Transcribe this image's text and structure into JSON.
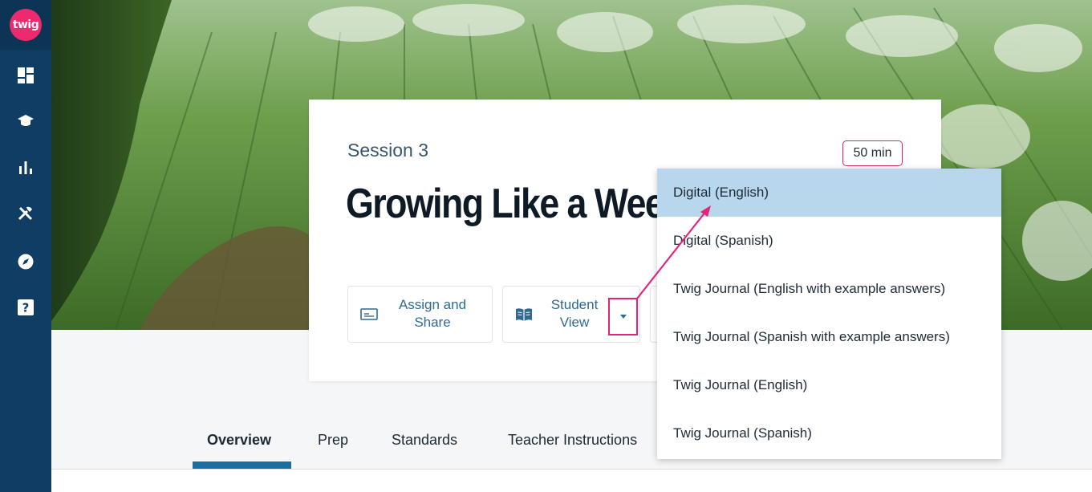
{
  "app": {
    "logo_text": "twig"
  },
  "sidebar": {
    "items": [
      {
        "name": "dashboard",
        "icon": "dashboard-icon"
      },
      {
        "name": "courses",
        "icon": "graduation-cap-icon"
      },
      {
        "name": "reports",
        "icon": "bar-chart-icon"
      },
      {
        "name": "tools",
        "icon": "tools-icon"
      },
      {
        "name": "explore",
        "icon": "compass-icon"
      },
      {
        "name": "help",
        "icon": "help-icon"
      }
    ]
  },
  "lesson": {
    "session": "Session 3",
    "duration": "50 min",
    "title": "Growing Like a Weed"
  },
  "actions": {
    "assign_label": "Assign and Share",
    "student_view_label": "Student View"
  },
  "dropdown": {
    "options": [
      "Digital (English)",
      "Digital (Spanish)",
      "Twig Journal (English with example answers)",
      "Twig Journal (Spanish with example answers)",
      "Twig Journal (English)",
      "Twig Journal (Spanish)"
    ],
    "selected_index": 0
  },
  "tabs": [
    {
      "label": "Overview",
      "active": true
    },
    {
      "label": "Prep",
      "active": false
    },
    {
      "label": "Standards",
      "active": false
    },
    {
      "label": "Teacher Instructions",
      "active": false
    }
  ],
  "colors": {
    "sidebar": "#0f3d63",
    "brand": "#ee2a6f",
    "highlight": "#e3247b",
    "link": "#2f6a95",
    "selected": "#b8d6ec"
  }
}
